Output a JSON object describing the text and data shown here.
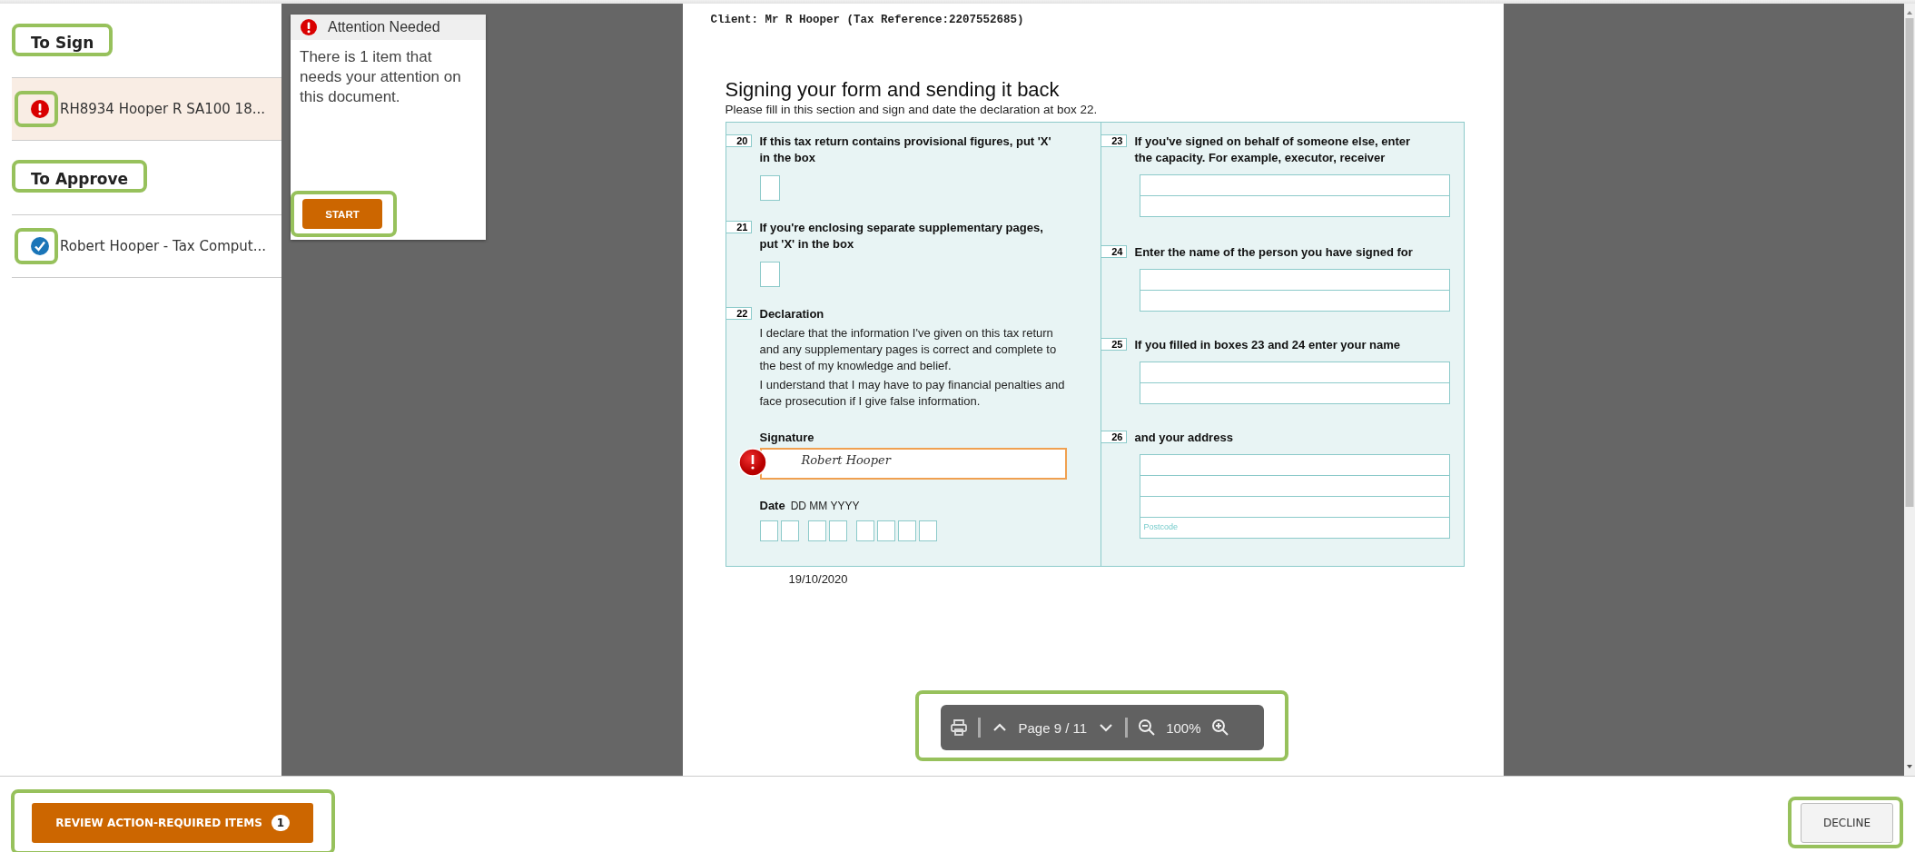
{
  "sidebar": {
    "sections": [
      {
        "title": "To Sign",
        "highlighted": true,
        "items": [
          {
            "label": "RH8934 Hooper R SA100 18...",
            "kind": "attention",
            "selected": true,
            "icon_highlighted": true
          }
        ]
      },
      {
        "title": "To Approve",
        "highlighted": true,
        "items": [
          {
            "label": "Robert Hooper - Tax Comput...",
            "kind": "done",
            "selected": false,
            "icon_highlighted": true
          }
        ]
      }
    ]
  },
  "attention_panel": {
    "title": "Attention Needed",
    "message": "There is 1 item that needs your attention on this document.",
    "button": {
      "label": "START",
      "highlighted": true
    }
  },
  "document": {
    "client_line": "Client: Mr R Hooper (Tax Reference:2207552685)",
    "heading": "Signing your form and sending it back",
    "instructions": "Please fill in this section and sign and date the declaration at box 22.",
    "left_boxes": [
      {
        "kind": "checkbox",
        "number": "20",
        "question": "If this tax return contains provisional figures, put 'X' in the box",
        "checked": false
      },
      {
        "kind": "checkbox",
        "number": "21",
        "question": "If you're enclosing separate supplementary pages, put 'X' in the box",
        "checked": false
      },
      {
        "kind": "declaration",
        "number": "22",
        "question": "Declaration",
        "paragraphs": [
          "I declare that the information I've given on this tax return and any supplementary pages is correct and complete to the best of my knowledge and belief.",
          "I understand that I may have to pay financial penalties and face prosecution if I give false information."
        ]
      }
    ],
    "signature": {
      "label": "Signature",
      "value": "Robert Hooper",
      "error": true
    },
    "date": {
      "label": "Date",
      "hint": "DD MM YYYY",
      "value": "19/10/2020"
    },
    "right_boxes": [
      {
        "kind": "lines",
        "number": "23",
        "question": "If you've signed on behalf of someone else, enter the capacity. For example, executor, receiver"
      },
      {
        "kind": "lines",
        "number": "24",
        "question": "Enter the name of the person you have signed for"
      },
      {
        "kind": "lines",
        "number": "25",
        "question": "If you filled in boxes 23 and 24 enter your name"
      },
      {
        "kind": "address",
        "number": "26",
        "question": "and your address",
        "postcode_placeholder": "Postcode"
      }
    ]
  },
  "toolbar": {
    "page": "Page 9 / 11",
    "zoom": "100%",
    "highlighted": true
  },
  "footer": {
    "review_button": {
      "label": "REVIEW ACTION-REQUIRED ITEMS",
      "badge": "1",
      "highlighted": true
    },
    "decline_button": {
      "label": "DECLINE",
      "highlighted": true
    }
  }
}
